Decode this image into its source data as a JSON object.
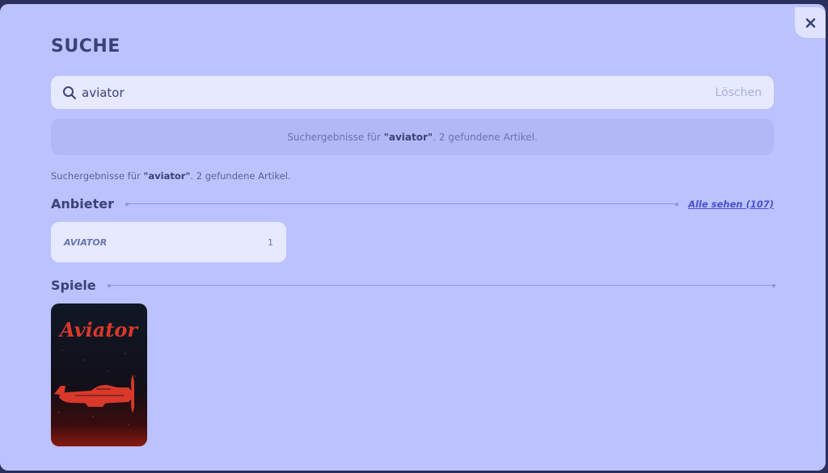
{
  "search": {
    "title": "SUCHE",
    "query": "aviator",
    "clear_label": "Löschen"
  },
  "results": {
    "prefix": "Suchergebnisse für ",
    "term": "\"aviator\"",
    "suffix": ". 2 gefundene Artikel."
  },
  "providers": {
    "heading": "Anbieter",
    "see_all": "Alle sehen (107)",
    "items": [
      {
        "name": "AVIATOR",
        "count": "1"
      }
    ]
  },
  "games": {
    "heading": "Spiele",
    "items": [
      {
        "logo_text": "Aviator"
      }
    ]
  },
  "colors": {
    "modal_bg": "#bcc2fd",
    "accent": "#4a4fd0",
    "aviator_red": "#d9382b"
  }
}
